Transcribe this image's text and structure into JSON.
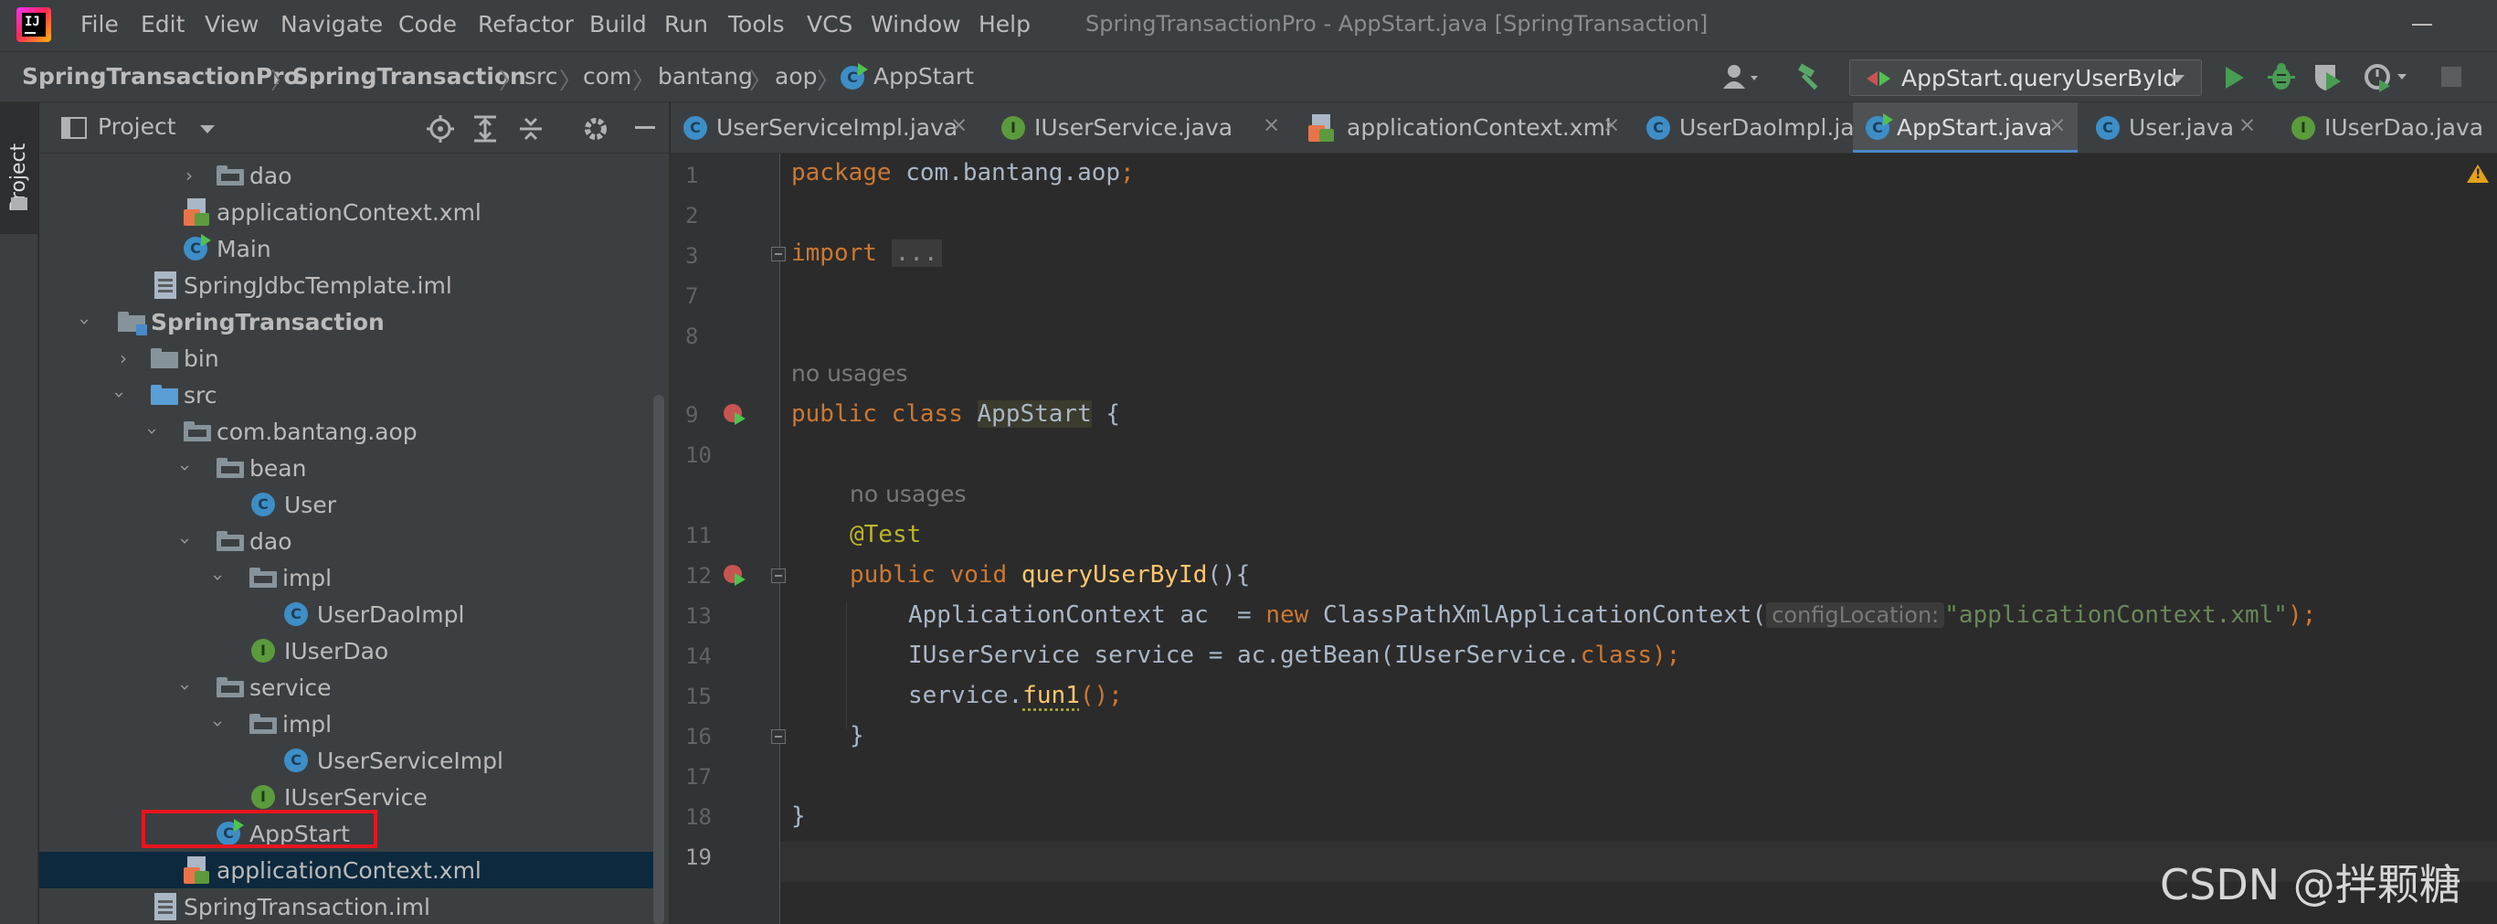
{
  "window": {
    "title": "SpringTransactionPro - AppStart.java [SpringTransaction]",
    "menu": [
      "File",
      "Edit",
      "View",
      "Navigate",
      "Code",
      "Refactor",
      "Build",
      "Run",
      "Tools",
      "VCS",
      "Window",
      "Help"
    ]
  },
  "breadcrumbs": [
    "SpringTransactionPro",
    "SpringTransaction",
    "src",
    "com",
    "bantang",
    "aop",
    "AppStart"
  ],
  "run_config": "AppStart.queryUserById",
  "project_panel": {
    "strip_label": "Project",
    "title": "Project",
    "tree": [
      {
        "label": "dao",
        "icon": "folder-package-icon"
      },
      {
        "label": "applicationContext.xml",
        "icon": "spring-xml-icon"
      },
      {
        "label": "Main",
        "icon": "runnable-class-icon"
      },
      {
        "label": "SpringJdbcTemplate.iml",
        "icon": "iml-file-icon"
      },
      {
        "label": "SpringTransaction",
        "icon": "module-folder-icon"
      },
      {
        "label": "bin",
        "icon": "folder-icon"
      },
      {
        "label": "src",
        "icon": "source-folder-icon"
      },
      {
        "label": "com.bantang.aop",
        "icon": "folder-package-icon"
      },
      {
        "label": "bean",
        "icon": "folder-package-icon"
      },
      {
        "label": "User",
        "icon": "class-icon"
      },
      {
        "label": "dao",
        "icon": "folder-package-icon"
      },
      {
        "label": "impl",
        "icon": "folder-package-icon"
      },
      {
        "label": "UserDaoImpl",
        "icon": "class-icon"
      },
      {
        "label": "IUserDao",
        "icon": "interface-icon"
      },
      {
        "label": "service",
        "icon": "folder-package-icon"
      },
      {
        "label": "impl",
        "icon": "folder-package-icon"
      },
      {
        "label": "UserServiceImpl",
        "icon": "class-icon"
      },
      {
        "label": "IUserService",
        "icon": "interface-icon"
      },
      {
        "label": "AppStart",
        "icon": "runnable-class-icon"
      },
      {
        "label": "applicationContext.xml",
        "icon": "spring-xml-icon"
      },
      {
        "label": "SpringTransaction.iml",
        "icon": "iml-file-icon"
      }
    ]
  },
  "tabs": [
    {
      "label": "UserServiceImpl.java",
      "icon": "class-icon"
    },
    {
      "label": "IUserService.java",
      "icon": "interface-icon"
    },
    {
      "label": "applicationContext.xml",
      "icon": "spring-xml-icon"
    },
    {
      "label": "UserDaoImpl.java",
      "icon": "class-icon"
    },
    {
      "label": "AppStart.java",
      "icon": "runnable-class-icon",
      "active": true
    },
    {
      "label": "User.java",
      "icon": "class-icon"
    },
    {
      "label": "IUserDao.java",
      "icon": "interface-icon"
    }
  ],
  "editor": {
    "line_numbers": [
      "1",
      "2",
      "3",
      "7",
      "8",
      "9",
      "10",
      "11",
      "12",
      "13",
      "14",
      "15",
      "16",
      "17",
      "18",
      "19"
    ],
    "usage_hint": "no usages",
    "param_hint": "configLocation:",
    "code": {
      "l1_kw": "package",
      "l1_rest": " com.bantang.aop",
      "l1_semi": ";",
      "l3_kw": "import",
      "l3_fold": "...",
      "l9_kw1": "public",
      "l9_kw2": "class",
      "l9_name": "AppStart",
      "l9_brace": "{",
      "l11_ann": "@Test",
      "l12_kw1": "public",
      "l12_kw2": "void",
      "l12_fn": "queryUserById",
      "l12_rest": "(){",
      "l13_a": "ApplicationContext ac  = ",
      "l13_new": "new",
      "l13_b": " ClassPathXmlApplicationContext(",
      "l13_str": "\"applicationContext.xml\"",
      "l13_end": ");",
      "l14_a": "IUserService service = ac.getBean(IUserService.",
      "l14_kw": "class",
      "l14_end": ");",
      "l15_a": "service.",
      "l15_fn": "fun1",
      "l15_end": "();",
      "l16": "}",
      "l18": "}"
    }
  },
  "watermark": "CSDN @拌颗糖"
}
